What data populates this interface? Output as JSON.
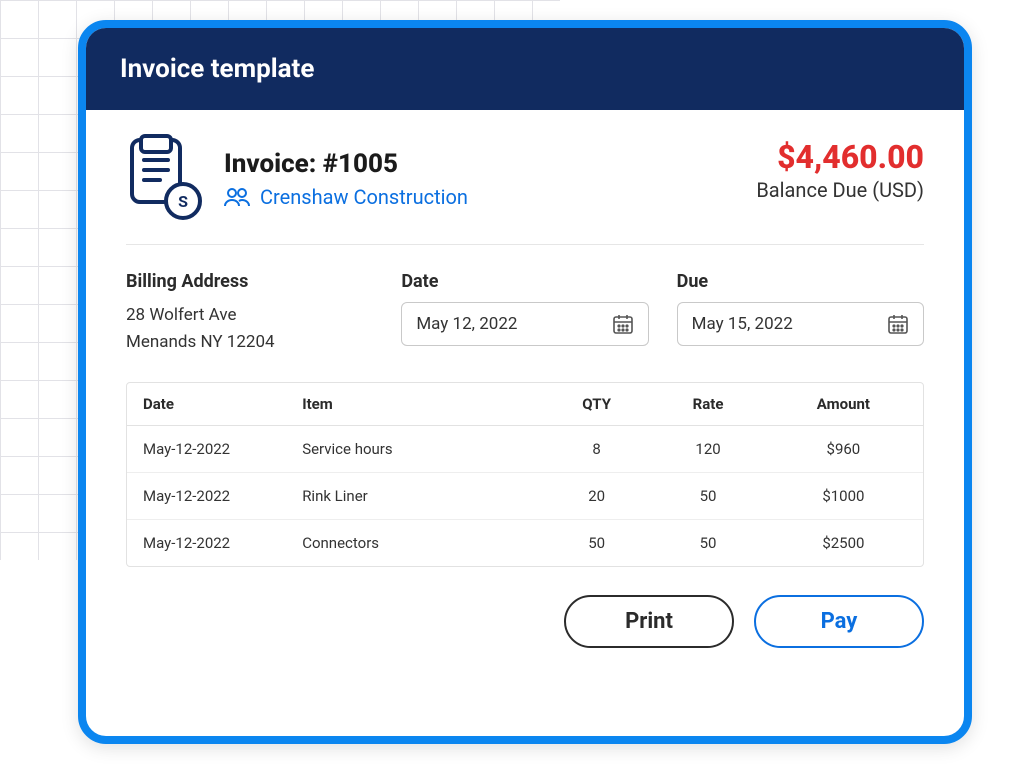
{
  "header": {
    "title": "Invoice template"
  },
  "invoice": {
    "number_label": "Invoice: #1005",
    "customer": "Crenshaw Construction",
    "balance_amount": "$4,460.00",
    "balance_label": "Balance Due (USD)",
    "coin_symbol": "S"
  },
  "billing": {
    "label": "Billing Address",
    "line1": "28 Wolfert Ave",
    "line2": "Menands NY 12204"
  },
  "dates": {
    "date_label": "Date",
    "date_value": "May 12, 2022",
    "due_label": "Due",
    "due_value": "May 15, 2022"
  },
  "table": {
    "headers": {
      "date": "Date",
      "item": "Item",
      "qty": "QTY",
      "rate": "Rate",
      "amount": "Amount"
    },
    "rows": [
      {
        "date": "May-12-2022",
        "item": "Service hours",
        "qty": "8",
        "rate": "120",
        "amount": "$960"
      },
      {
        "date": "May-12-2022",
        "item": "Rink Liner",
        "qty": "20",
        "rate": "50",
        "amount": "$1000"
      },
      {
        "date": "May-12-2022",
        "item": "Connectors",
        "qty": "50",
        "rate": "50",
        "amount": "$2500"
      }
    ]
  },
  "actions": {
    "print": "Print",
    "pay": "Pay"
  }
}
